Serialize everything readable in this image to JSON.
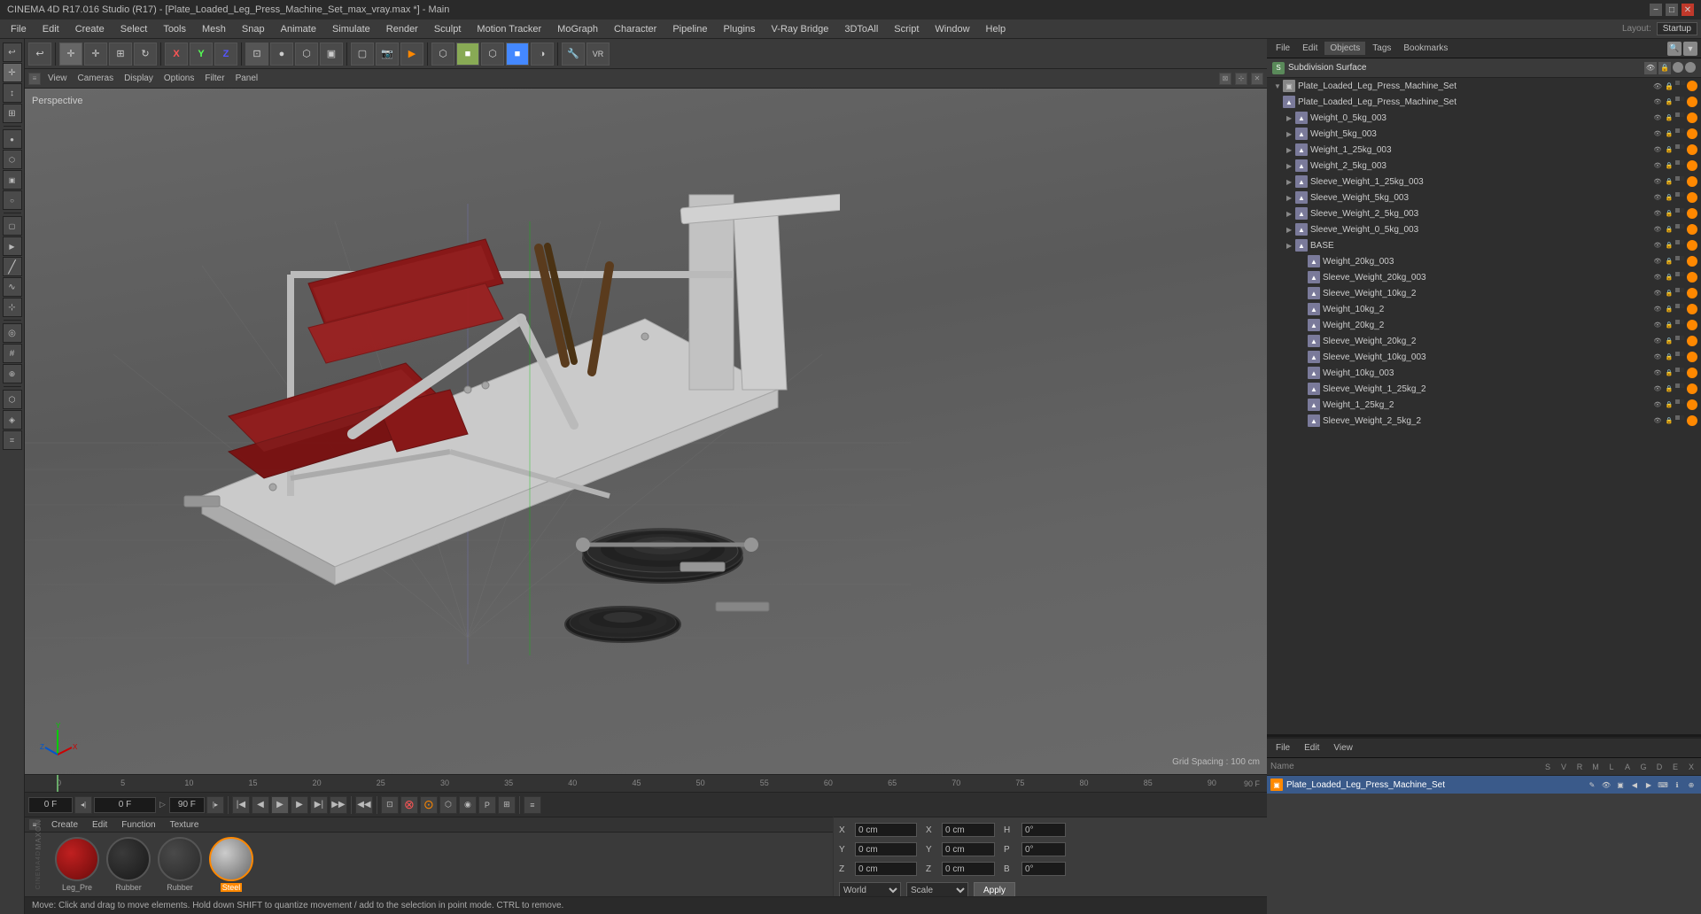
{
  "titlebar": {
    "title": "CINEMA 4D R17.016 Studio (R17) - [Plate_Loaded_Leg_Press_Machine_Set_max_vray.max *] - Main",
    "minimize": "−",
    "maximize": "□",
    "close": "✕"
  },
  "menubar": {
    "items": [
      "File",
      "Edit",
      "Create",
      "Select",
      "Tools",
      "Mesh",
      "Snap",
      "Animate",
      "Simulate",
      "Render",
      "Sculpt",
      "Motion Tracker",
      "MoGraph",
      "Character",
      "Pipeline",
      "Plugins",
      "V-Ray Bridge",
      "3DToAll",
      "Script",
      "Window",
      "Help"
    ]
  },
  "toolbar": {
    "layout_label": "Layout:",
    "layout_value": "Startup"
  },
  "viewport": {
    "label": "Perspective",
    "header_items": [
      "View",
      "Cameras",
      "Display",
      "Options",
      "Filter",
      "Panel"
    ],
    "grid_spacing": "Grid Spacing : 100 cm"
  },
  "timeline": {
    "start": "0 F",
    "end": "90 F",
    "current": "0 F",
    "ticks": [
      "0",
      "5",
      "10",
      "15",
      "20",
      "25",
      "30",
      "35",
      "40",
      "45",
      "50",
      "55",
      "60",
      "65",
      "70",
      "75",
      "80",
      "85",
      "90"
    ]
  },
  "transport": {
    "frame_current": "0 F",
    "frame_end": "90 F"
  },
  "object_manager": {
    "tabs": [
      "File",
      "Edit",
      "Objects",
      "Tags",
      "Bookmarks"
    ],
    "root": "Subdivision Surface",
    "items": [
      {
        "name": "Plate_Loaded_Leg_Press_Machine_Set",
        "level": 1,
        "expanded": true,
        "color": "orange"
      },
      {
        "name": "Weight_0_5kg_003",
        "level": 2
      },
      {
        "name": "Weight_5kg_003",
        "level": 2
      },
      {
        "name": "Weight_1_25kg_003",
        "level": 2
      },
      {
        "name": "Weight_2_5kg_003",
        "level": 2
      },
      {
        "name": "Sleeve_Weight_1_25kg_003",
        "level": 2
      },
      {
        "name": "Sleeve_Weight_5kg_003",
        "level": 2
      },
      {
        "name": "Sleeve_Weight_2_5kg_003",
        "level": 2
      },
      {
        "name": "Sleeve_Weight_0_5kg_003",
        "level": 2
      },
      {
        "name": "BASE",
        "level": 2
      },
      {
        "name": "Weight_20kg_003",
        "level": 3
      },
      {
        "name": "Sleeve_Weight_20kg_003",
        "level": 3
      },
      {
        "name": "Sleeve_Weight_10kg_2",
        "level": 3
      },
      {
        "name": "Weight_10kg_2",
        "level": 3
      },
      {
        "name": "Weight_20kg_2",
        "level": 3
      },
      {
        "name": "Sleeve_Weight_20kg_2",
        "level": 3
      },
      {
        "name": "Sleeve_Weight_10kg_003",
        "level": 3
      },
      {
        "name": "Weight_10kg_003",
        "level": 3
      },
      {
        "name": "Sleeve_Weight_1_25kg_2",
        "level": 3
      },
      {
        "name": "Weight_1_25kg_2",
        "level": 3
      },
      {
        "name": "Sleeve_Weight_2_5kg_2",
        "level": 3
      }
    ]
  },
  "lower_panel": {
    "tabs": [
      "File",
      "Edit",
      "View"
    ],
    "col_headers": [
      "S",
      "V",
      "R",
      "M",
      "L",
      "A",
      "G",
      "D",
      "E",
      "X"
    ],
    "selected_item": {
      "name": "Plate_Loaded_Leg_Press_Machine_Set",
      "color": "orange"
    }
  },
  "coordinates": {
    "x_pos": "0 cm",
    "y_pos": "0 cm",
    "z_pos": "0 cm",
    "x_rot": "0 cm",
    "y_rot": "0 cm",
    "z_rot": "0 cm",
    "h_val": "0°",
    "p_val": "0°",
    "b_val": "0°",
    "mode": "World",
    "scale_mode": "Scale",
    "apply_label": "Apply"
  },
  "materials": {
    "header": [
      "Create",
      "Edit",
      "Function",
      "Texture"
    ],
    "items": [
      {
        "name": "Leg_Pre",
        "color": "#8B2020"
      },
      {
        "name": "Rubber",
        "color": "#2a2a2a"
      },
      {
        "name": "Rubber",
        "color": "#3a3a3a"
      },
      {
        "name": "Steel",
        "color": "#888888",
        "selected": true
      }
    ]
  },
  "statusbar": {
    "text": "Move: Click and drag to move elements. Hold down SHIFT to quantize movement / add to the selection in point mode. CTRL to remove."
  },
  "icons": {
    "undo": "↩",
    "redo": "↪",
    "live_select": "✛",
    "move": "✛",
    "scale": "⊞",
    "rotate": "↻",
    "axis_x": "X",
    "axis_y": "Y",
    "axis_z": "Z",
    "render": "▶",
    "play": "▶",
    "stop": "■",
    "rewind": "◀◀",
    "forward": "▶▶"
  }
}
